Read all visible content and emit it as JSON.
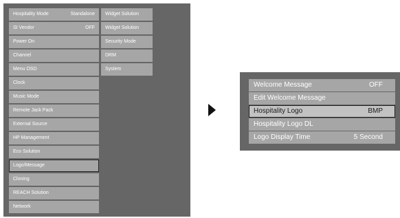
{
  "main_menu": {
    "column1": [
      {
        "label": "Hospitality Mode",
        "value": "Standalone"
      },
      {
        "label": "SI Vendor",
        "value": "OFF"
      },
      {
        "label": "Power On",
        "value": ""
      },
      {
        "label": "Channel",
        "value": ""
      },
      {
        "label": "Menu OSD",
        "value": ""
      },
      {
        "label": "Clock",
        "value": ""
      },
      {
        "label": "Music Mode",
        "value": ""
      },
      {
        "label": "Remote Jack Pack",
        "value": ""
      },
      {
        "label": "External Source",
        "value": ""
      },
      {
        "label": "HP Management",
        "value": ""
      },
      {
        "label": "Eco Solution",
        "value": ""
      },
      {
        "label": "Logo/Message",
        "value": "",
        "selected": true
      },
      {
        "label": "Cloning",
        "value": ""
      },
      {
        "label": "REACH Solution",
        "value": ""
      },
      {
        "label": "Network",
        "value": ""
      }
    ],
    "column2": [
      {
        "label": "Widget Solution"
      },
      {
        "label": "Widget Solution"
      },
      {
        "label": "Security Mode"
      },
      {
        "label": "DRM"
      },
      {
        "label": "System"
      }
    ]
  },
  "submenu": {
    "items": [
      {
        "label": "Welcome Message",
        "value": "OFF"
      },
      {
        "label": "Edit Welcome Message",
        "value": ""
      },
      {
        "label": "Hospitality Logo",
        "value": "BMP",
        "selected": true
      },
      {
        "label": "Hospitality Logo DL",
        "value": ""
      },
      {
        "label": "Logo Display Time",
        "value": "5 Second"
      }
    ]
  },
  "colors": {
    "panel_bg": "#666666",
    "item_bg": "#a6a6a6",
    "selected_item_bg": "#c2c2c2",
    "selected_border": "#222222",
    "text": "#ffffff"
  }
}
